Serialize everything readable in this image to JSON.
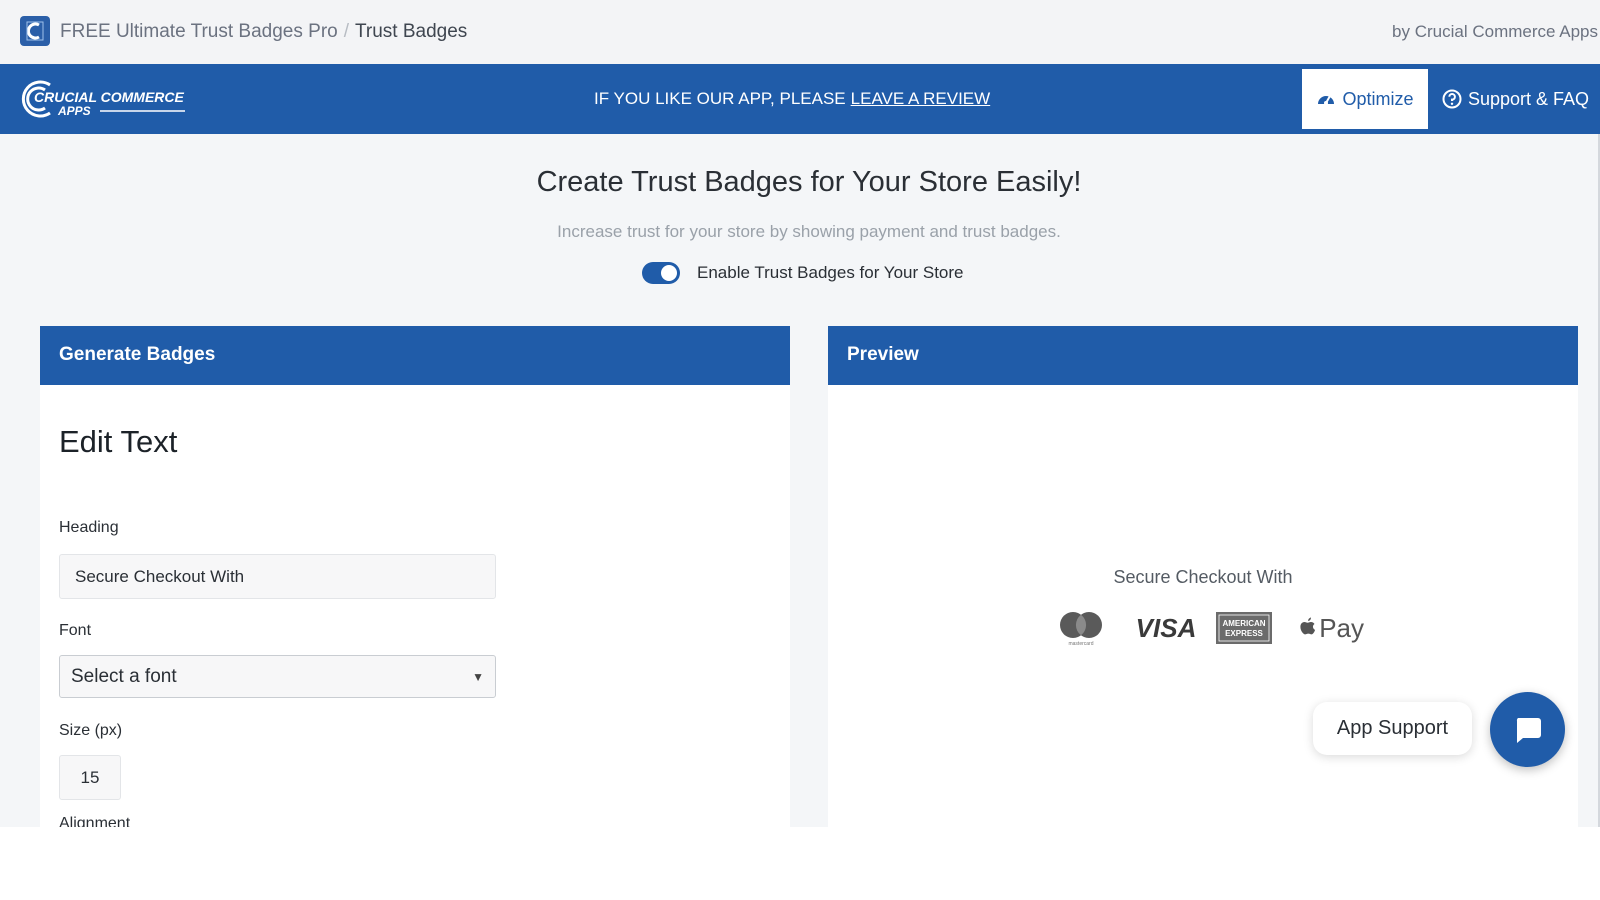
{
  "breadcrumb": {
    "app_name": "FREE Ultimate Trust Badges Pro",
    "separator": "/",
    "current": "Trust Badges"
  },
  "byline": "by Crucial Commerce Apps",
  "header": {
    "logo_line1": "CRUCIAL COMMERCE",
    "logo_line2": "APPS",
    "promo_text": "IF YOU LIKE OUR APP, PLEASE",
    "promo_link": "LEAVE A REVIEW",
    "nav": [
      {
        "label": "Optimize",
        "icon": "gauge-icon",
        "active": true
      },
      {
        "label": "Support & FAQ",
        "icon": "question-circle-icon",
        "active": false
      }
    ]
  },
  "hero": {
    "title": "Create Trust Badges for Your Store Easily!",
    "subtitle": "Increase trust for your store by showing payment and trust badges.",
    "toggle_label": "Enable Trust Badges for Your Store",
    "toggle_on": true
  },
  "generate": {
    "title": "Generate Badges",
    "section_title": "Edit Text",
    "heading_label": "Heading",
    "heading_value": "Secure Checkout With",
    "font_label": "Font",
    "font_value": "Select a font",
    "size_label": "Size (px)",
    "size_value": "15",
    "next_label": "Alignment"
  },
  "preview": {
    "title": "Preview",
    "heading": "Secure Checkout With",
    "badges": [
      {
        "name": "Mastercard",
        "icon": "mastercard-icon",
        "caption": "mastercard"
      },
      {
        "name": "Visa",
        "icon": "visa-icon",
        "text": "VISA"
      },
      {
        "name": "American Express",
        "icon": "amex-icon",
        "line1": "AMERICAN",
        "line2": "EXPRESS"
      },
      {
        "name": "Apple Pay",
        "icon": "apple-pay-icon",
        "text": "Pay"
      }
    ]
  },
  "support_widget": {
    "label": "App Support",
    "icon": "chat-bubble-icon"
  },
  "colors": {
    "brand_blue": "#205ca9",
    "topbar_bg": "#f3f4f6",
    "page_bg": "#f4f6f8"
  }
}
